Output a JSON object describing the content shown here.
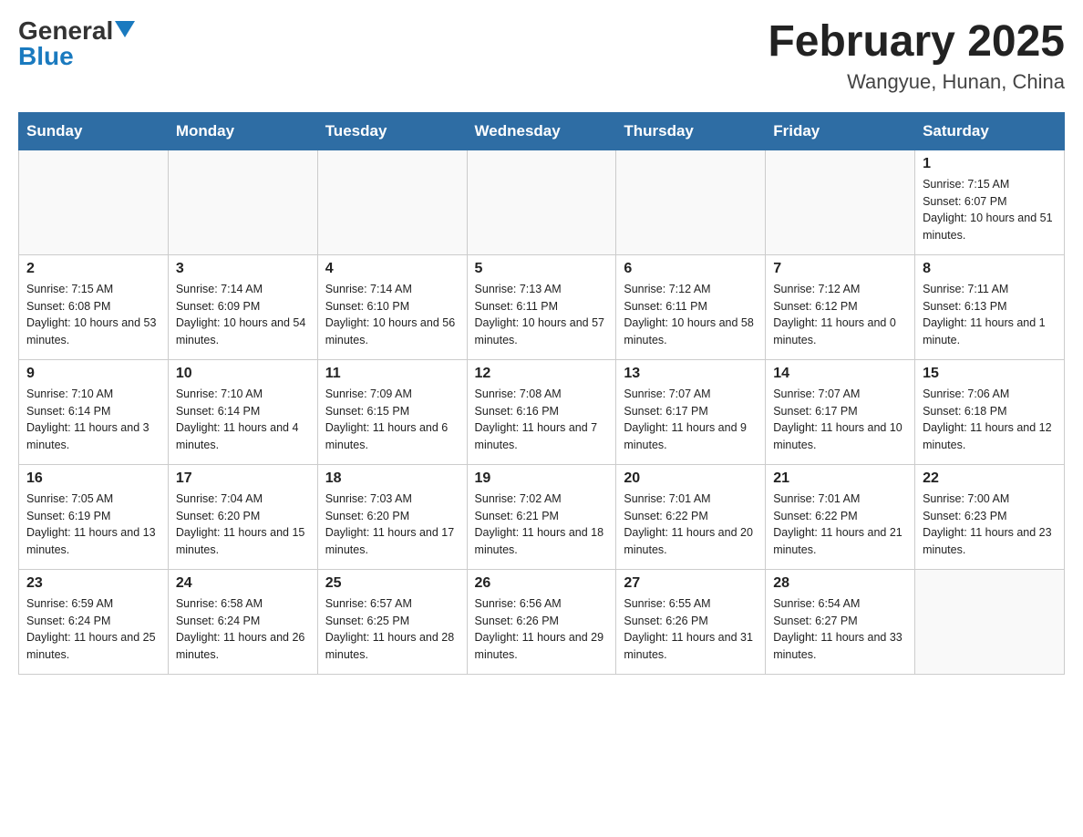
{
  "header": {
    "logo_general": "General",
    "logo_blue": "Blue",
    "title": "February 2025",
    "subtitle": "Wangyue, Hunan, China"
  },
  "weekdays": [
    "Sunday",
    "Monday",
    "Tuesday",
    "Wednesday",
    "Thursday",
    "Friday",
    "Saturday"
  ],
  "weeks": [
    [
      {
        "day": "",
        "info": ""
      },
      {
        "day": "",
        "info": ""
      },
      {
        "day": "",
        "info": ""
      },
      {
        "day": "",
        "info": ""
      },
      {
        "day": "",
        "info": ""
      },
      {
        "day": "",
        "info": ""
      },
      {
        "day": "1",
        "info": "Sunrise: 7:15 AM\nSunset: 6:07 PM\nDaylight: 10 hours and 51 minutes."
      }
    ],
    [
      {
        "day": "2",
        "info": "Sunrise: 7:15 AM\nSunset: 6:08 PM\nDaylight: 10 hours and 53 minutes."
      },
      {
        "day": "3",
        "info": "Sunrise: 7:14 AM\nSunset: 6:09 PM\nDaylight: 10 hours and 54 minutes."
      },
      {
        "day": "4",
        "info": "Sunrise: 7:14 AM\nSunset: 6:10 PM\nDaylight: 10 hours and 56 minutes."
      },
      {
        "day": "5",
        "info": "Sunrise: 7:13 AM\nSunset: 6:11 PM\nDaylight: 10 hours and 57 minutes."
      },
      {
        "day": "6",
        "info": "Sunrise: 7:12 AM\nSunset: 6:11 PM\nDaylight: 10 hours and 58 minutes."
      },
      {
        "day": "7",
        "info": "Sunrise: 7:12 AM\nSunset: 6:12 PM\nDaylight: 11 hours and 0 minutes."
      },
      {
        "day": "8",
        "info": "Sunrise: 7:11 AM\nSunset: 6:13 PM\nDaylight: 11 hours and 1 minute."
      }
    ],
    [
      {
        "day": "9",
        "info": "Sunrise: 7:10 AM\nSunset: 6:14 PM\nDaylight: 11 hours and 3 minutes."
      },
      {
        "day": "10",
        "info": "Sunrise: 7:10 AM\nSunset: 6:14 PM\nDaylight: 11 hours and 4 minutes."
      },
      {
        "day": "11",
        "info": "Sunrise: 7:09 AM\nSunset: 6:15 PM\nDaylight: 11 hours and 6 minutes."
      },
      {
        "day": "12",
        "info": "Sunrise: 7:08 AM\nSunset: 6:16 PM\nDaylight: 11 hours and 7 minutes."
      },
      {
        "day": "13",
        "info": "Sunrise: 7:07 AM\nSunset: 6:17 PM\nDaylight: 11 hours and 9 minutes."
      },
      {
        "day": "14",
        "info": "Sunrise: 7:07 AM\nSunset: 6:17 PM\nDaylight: 11 hours and 10 minutes."
      },
      {
        "day": "15",
        "info": "Sunrise: 7:06 AM\nSunset: 6:18 PM\nDaylight: 11 hours and 12 minutes."
      }
    ],
    [
      {
        "day": "16",
        "info": "Sunrise: 7:05 AM\nSunset: 6:19 PM\nDaylight: 11 hours and 13 minutes."
      },
      {
        "day": "17",
        "info": "Sunrise: 7:04 AM\nSunset: 6:20 PM\nDaylight: 11 hours and 15 minutes."
      },
      {
        "day": "18",
        "info": "Sunrise: 7:03 AM\nSunset: 6:20 PM\nDaylight: 11 hours and 17 minutes."
      },
      {
        "day": "19",
        "info": "Sunrise: 7:02 AM\nSunset: 6:21 PM\nDaylight: 11 hours and 18 minutes."
      },
      {
        "day": "20",
        "info": "Sunrise: 7:01 AM\nSunset: 6:22 PM\nDaylight: 11 hours and 20 minutes."
      },
      {
        "day": "21",
        "info": "Sunrise: 7:01 AM\nSunset: 6:22 PM\nDaylight: 11 hours and 21 minutes."
      },
      {
        "day": "22",
        "info": "Sunrise: 7:00 AM\nSunset: 6:23 PM\nDaylight: 11 hours and 23 minutes."
      }
    ],
    [
      {
        "day": "23",
        "info": "Sunrise: 6:59 AM\nSunset: 6:24 PM\nDaylight: 11 hours and 25 minutes."
      },
      {
        "day": "24",
        "info": "Sunrise: 6:58 AM\nSunset: 6:24 PM\nDaylight: 11 hours and 26 minutes."
      },
      {
        "day": "25",
        "info": "Sunrise: 6:57 AM\nSunset: 6:25 PM\nDaylight: 11 hours and 28 minutes."
      },
      {
        "day": "26",
        "info": "Sunrise: 6:56 AM\nSunset: 6:26 PM\nDaylight: 11 hours and 29 minutes."
      },
      {
        "day": "27",
        "info": "Sunrise: 6:55 AM\nSunset: 6:26 PM\nDaylight: 11 hours and 31 minutes."
      },
      {
        "day": "28",
        "info": "Sunrise: 6:54 AM\nSunset: 6:27 PM\nDaylight: 11 hours and 33 minutes."
      },
      {
        "day": "",
        "info": ""
      }
    ]
  ]
}
